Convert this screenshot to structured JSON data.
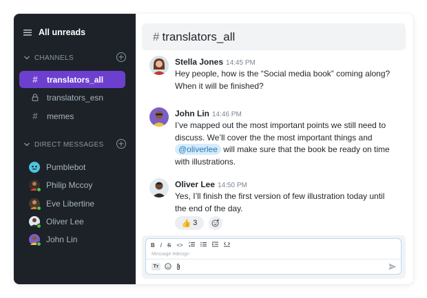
{
  "sidebar": {
    "header": {
      "title": "All unreads",
      "icon": "list-icon"
    },
    "channels_section": {
      "label": "CHANNELS"
    },
    "channels": [
      {
        "symbol": "#",
        "name": "translators_all",
        "active": true,
        "icon": "hash-icon"
      },
      {
        "symbol": "lock",
        "name": "translators_esn",
        "active": false,
        "icon": "lock-icon"
      },
      {
        "symbol": "#",
        "name": "memes",
        "active": false,
        "icon": "hash-icon"
      }
    ],
    "dm_section": {
      "label": "DIRECT MESSAGES"
    },
    "direct_messages": [
      {
        "name": "Pumblebot",
        "online": false,
        "avatar_color": "#4ec3e0"
      },
      {
        "name": "Philip Mccoy",
        "online": true,
        "avatar_color": "#5a3b2e"
      },
      {
        "name": "Eve Libertine",
        "online": true,
        "avatar_color": "#8a5a3c"
      },
      {
        "name": "Oliver Lee",
        "online": true,
        "avatar_color": "#d9e3ea"
      },
      {
        "name": "John Lin",
        "online": true,
        "avatar_color": "#7b5fc4"
      }
    ]
  },
  "channel": {
    "hash": "#",
    "name": "translators_all"
  },
  "messages": [
    {
      "author": "Stella Jones",
      "time": "14:45 PM",
      "lines": [
        "Hey people, how is the “Social media book” coming along?",
        "When it will be finished?"
      ]
    },
    {
      "author": "John Lin",
      "time": "14:46 PM",
      "lines": [
        "I’ve mapped out the most important points we still need to",
        "discuss. We’ll cover the the most important things and"
      ],
      "mention": "@oliverlee",
      "after_mention": " will make sure that the book be ready on time",
      "last_line": "with illustrations."
    },
    {
      "author": "Oliver Lee",
      "time": "14:50 PM",
      "lines": [
        "Yes, I’ll finish the first version of few illustration today until",
        "the end of the day."
      ],
      "reaction": {
        "emoji": "👍",
        "count": "3"
      }
    }
  ],
  "composer": {
    "toolbar": [
      "B",
      "I",
      "S",
      "<>",
      "ol",
      "ul",
      "indent",
      "code-block"
    ],
    "placeholder": "Message #design",
    "bottom_tools": [
      "Tт",
      "☺",
      "📎"
    ]
  },
  "colors": {
    "sidebar_bg": "#1c2228",
    "active_channel": "#6d3fcf",
    "mention_bg": "#d6ecfb",
    "mention_text": "#2779b8",
    "online": "#4fc94a"
  }
}
